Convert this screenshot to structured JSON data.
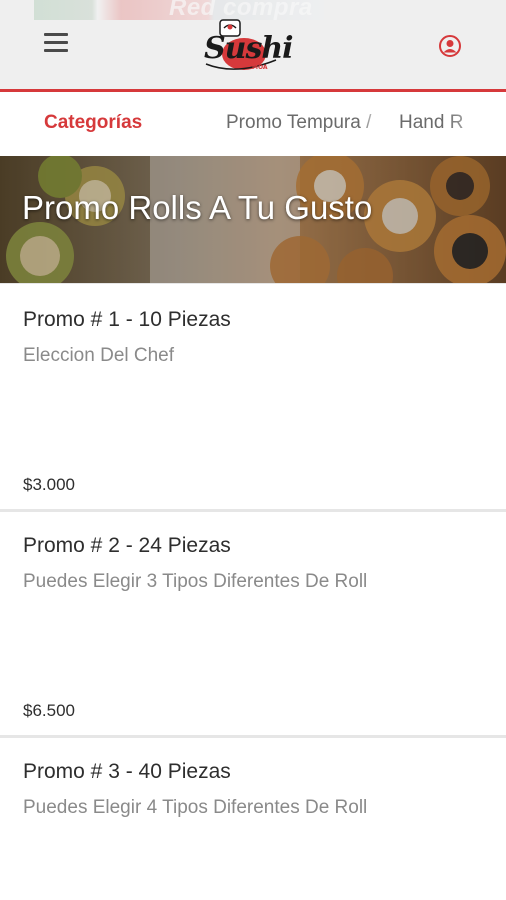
{
  "header": {
    "banner_text": "Red compra",
    "logo_text": "Sushi",
    "logo_sub": "MOA",
    "menu_icon": "hamburger-menu-icon",
    "user_icon": "user-account-icon",
    "accent_color": "#d6393b"
  },
  "tabs": [
    {
      "label": "Categorías",
      "active": true
    },
    {
      "label": "Promo Tempura /",
      "active": false
    },
    {
      "label": "Hand R",
      "active": false
    }
  ],
  "category": {
    "title": "Promo Rolls A Tu Gusto"
  },
  "items": [
    {
      "name": "Promo # 1 - 10 Piezas",
      "description": "Eleccion Del Chef",
      "price": "$3.000"
    },
    {
      "name": "Promo # 2 - 24 Piezas",
      "description": "Puedes Elegir 3 Tipos Diferentes De Roll",
      "price": "$6.500"
    },
    {
      "name": "Promo # 3 - 40 Piezas",
      "description": "Puedes Elegir 4 Tipos Diferentes De Roll",
      "price": ""
    }
  ]
}
